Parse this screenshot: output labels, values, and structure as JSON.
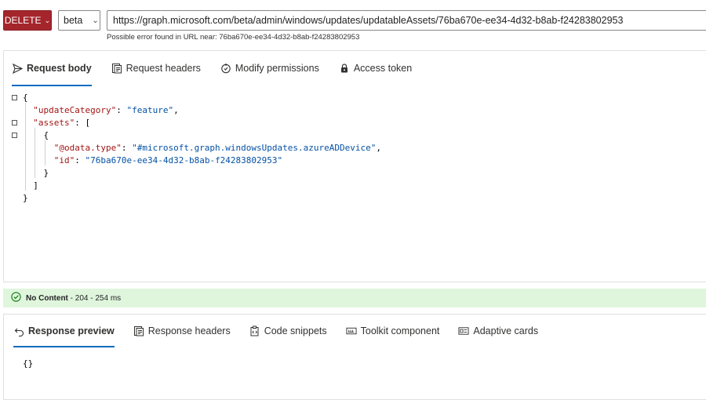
{
  "toolbar": {
    "method": "DELETE",
    "version": "beta",
    "url": "https://graph.microsoft.com/beta/admin/windows/updates/updatableAssets/76ba670e-ee34-4d32-b8ab-f24283802953",
    "url_error": "Possible error found in URL near: 76ba670e-ee34-4d32-b8ab-f24283802953"
  },
  "request_tabs": [
    {
      "label": "Request body",
      "icon": "send-icon",
      "active": true
    },
    {
      "label": "Request headers",
      "icon": "headers-icon",
      "active": false
    },
    {
      "label": "Modify permissions",
      "icon": "shield-icon",
      "active": false
    },
    {
      "label": "Access token",
      "icon": "lock-icon",
      "active": false
    }
  ],
  "request_body": {
    "open_brace": "{",
    "k1": "\"updateCategory\"",
    "v1": "\"feature\"",
    "k2": "\"assets\"",
    "arr_open": "[",
    "obj_open": "{",
    "k3": "\"@odata.type\"",
    "v3": "\"#microsoft.graph.windowsUpdates.azureADDevice\"",
    "k4": "\"id\"",
    "v4": "\"76ba670e-ee34-4d32-b8ab-f24283802953\"",
    "obj_close": "}",
    "arr_close": "]",
    "close_brace": "}"
  },
  "status": {
    "label": "No Content",
    "detail": "- 204 - 254 ms",
    "color": "#dff6dd"
  },
  "response_tabs": [
    {
      "label": "Response preview",
      "icon": "undo-icon",
      "active": true
    },
    {
      "label": "Response headers",
      "icon": "headers-icon",
      "active": false
    },
    {
      "label": "Code snippets",
      "icon": "code-icon",
      "active": false
    },
    {
      "label": "Toolkit component",
      "icon": "toolkit-icon",
      "active": false
    },
    {
      "label": "Adaptive cards",
      "icon": "card-icon",
      "active": false
    }
  ],
  "response_body": "{}"
}
